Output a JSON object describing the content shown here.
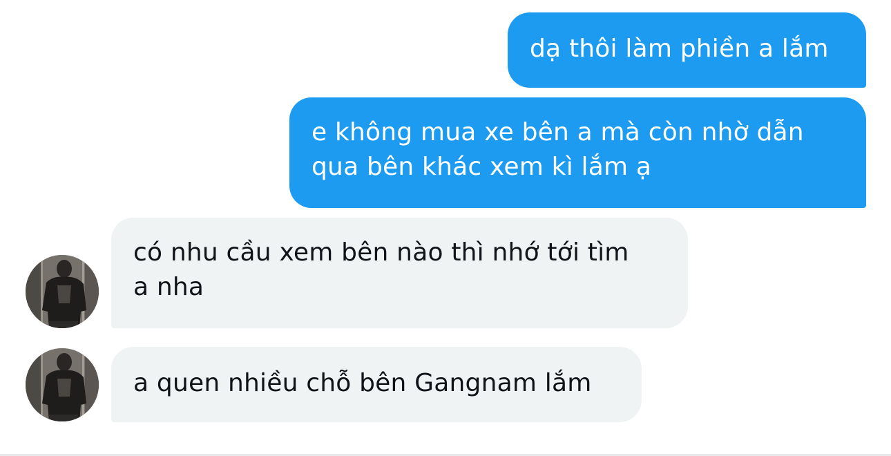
{
  "conversation": {
    "messages": [
      {
        "direction": "outgoing",
        "text": "dạ thôi làm phiền a lắm"
      },
      {
        "direction": "outgoing",
        "text": "e không mua xe bên a mà còn nhờ dẫn\nqua bên khác xem kì lắm ạ"
      },
      {
        "direction": "incoming",
        "text": "có nhu cầu xem bên nào thì nhớ tới tìm\na nha"
      },
      {
        "direction": "incoming",
        "text": "a quen nhiều chỗ bên Gangnam lắm"
      }
    ]
  },
  "colors": {
    "outgoing_bubble": "#1d9bf0",
    "incoming_bubble": "#eff3f4",
    "outgoing_text": "#ffffff",
    "incoming_text": "#0f1419"
  }
}
